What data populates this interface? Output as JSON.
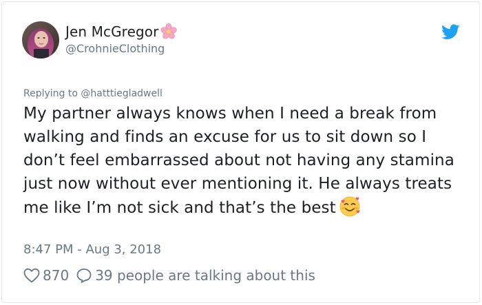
{
  "tweet": {
    "author": {
      "display_name": "Jen McGregor",
      "handle": "@CrohnieClothing",
      "name_emoji": "cherry-blossom-icon"
    },
    "reply_prefix": "Replying to",
    "reply_to": "@hatttiegladwell",
    "text": "My partner always knows when I need a break from walking and finds an excuse for us to sit down so I don’t feel embarrassed about not having any stamina just now without ever mentioning it. He always treats me like I’m not sick and that’s the best",
    "text_emoji": "smiling-face-with-hearts-icon",
    "timestamp": "8:47 PM - Aug 3, 2018",
    "likes": "870",
    "talking": "39 people are talking about this"
  },
  "colors": {
    "primary_text": "#1c2022",
    "secondary_text": "#697882",
    "twitter_blue": "#1da1f2",
    "border": "#e1e8ed"
  },
  "icons": [
    "twitter-bird-icon",
    "heart-icon",
    "speech-bubble-icon"
  ]
}
